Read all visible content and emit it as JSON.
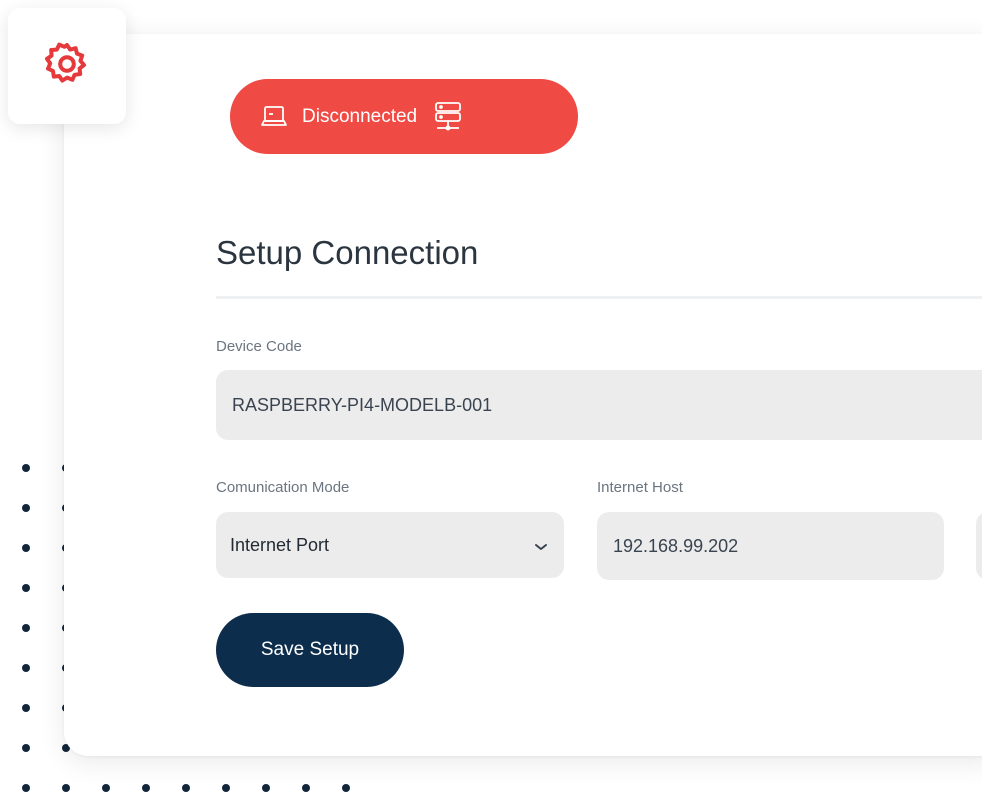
{
  "status": {
    "label": "Disconnected",
    "color": "#ef4a44"
  },
  "page": {
    "title": "Setup Connection"
  },
  "form": {
    "device_code": {
      "label": "Device Code",
      "value": "RASPBERRY-PI4-MODELB-001"
    },
    "communication_mode": {
      "label": "Comunication Mode",
      "value": "Internet Port"
    },
    "internet_host": {
      "label": "Internet Host",
      "value": "192.168.99.202"
    }
  },
  "actions": {
    "save_label": "Save Setup"
  },
  "colors": {
    "accent_red": "#ef4a44",
    "primary_navy": "#0d2d4d",
    "field_bg": "#ececec"
  },
  "icons": {
    "settings": "gear-icon",
    "status_left": "laptop-icon",
    "status_right": "network-server-icon",
    "select": "chevron-down-icon"
  }
}
